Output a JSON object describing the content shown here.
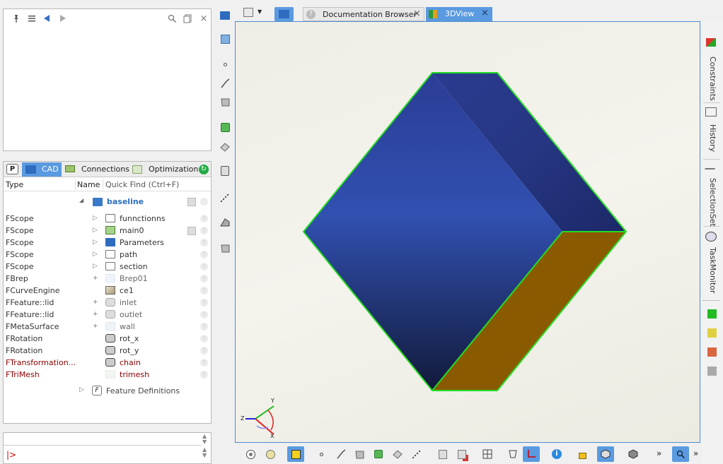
{
  "top_panel": {
    "pin": "pin-icon",
    "list": "list-icon",
    "back": "back-arrow-icon",
    "forward": "forward-arrow-icon",
    "search": "search-icon",
    "copy": "copy-icon",
    "close": "×"
  },
  "tabs": {
    "p": "P",
    "cad": "CAD",
    "connections": "Connections",
    "optimization": "Optimization"
  },
  "columns": {
    "type": "Type",
    "name": "Name",
    "quickfind": "Quick Find (Ctrl+F)"
  },
  "tree": {
    "root": "baseline",
    "rows": [
      {
        "type": "FScope",
        "expander": "▷",
        "name": "funnctionns",
        "icon": "folder-white",
        "style": "normal"
      },
      {
        "type": "FScope",
        "expander": "▷",
        "name": "main0",
        "icon": "folder-green",
        "style": "normal"
      },
      {
        "type": "FScope",
        "expander": "▷",
        "name": "Parameters",
        "icon": "folder-blue",
        "style": "normal"
      },
      {
        "type": "FScope",
        "expander": "▷",
        "name": "path",
        "icon": "folder-white",
        "style": "normal"
      },
      {
        "type": "FScope",
        "expander": "▷",
        "name": "section",
        "icon": "folder-white",
        "style": "normal"
      },
      {
        "type": "FBrep",
        "expander": "+",
        "name": "Brep01",
        "icon": "brep",
        "style": "muted"
      },
      {
        "type": "FCurveEngine",
        "expander": "",
        "name": "ce1",
        "icon": "curve",
        "style": "normal"
      },
      {
        "type": "FFeature::lid",
        "expander": "+",
        "name": "inlet",
        "icon": "surface",
        "style": "muted"
      },
      {
        "type": "FFeature::lid",
        "expander": "+",
        "name": "outlet",
        "icon": "surface",
        "style": "muted"
      },
      {
        "type": "FMetaSurface",
        "expander": "+",
        "name": "wall",
        "icon": "surface-light",
        "style": "muted"
      },
      {
        "type": "FRotation",
        "expander": "",
        "name": "rot_x",
        "icon": "rotation",
        "style": "normal"
      },
      {
        "type": "FRotation",
        "expander": "",
        "name": "rot_y",
        "icon": "rotation",
        "style": "normal"
      },
      {
        "type": "FTransformation...",
        "expander": "",
        "name": "chain",
        "icon": "rotation",
        "style": "red"
      },
      {
        "type": "FTriMesh",
        "expander": "",
        "name": "trimesh",
        "icon": "mesh",
        "style": "red"
      }
    ],
    "feature_definitions": "Feature Definitions",
    "feature_definitions_badge": "F"
  },
  "console": {
    "prompt": "|>",
    "input": ""
  },
  "doc_tabs": [
    {
      "label": "Documentation Browser",
      "close": "×"
    },
    {
      "label": "3DView",
      "close": "×"
    }
  ],
  "right_tabs": [
    "Constraints",
    "History",
    "SelectionSet",
    "TaskMonitor"
  ],
  "status_colors": [
    "#22bb22",
    "#e0d040",
    "#d9663f",
    "#aaaaaa"
  ],
  "axes": {
    "x": "X",
    "y": "Y",
    "z": "Z"
  },
  "bottom_toolbar_more": "»",
  "colors": {
    "accent": "#4a8ed4",
    "cube_blue": "#2f47a4",
    "cube_brown": "#8a5a00",
    "edge": "#22dd22"
  }
}
